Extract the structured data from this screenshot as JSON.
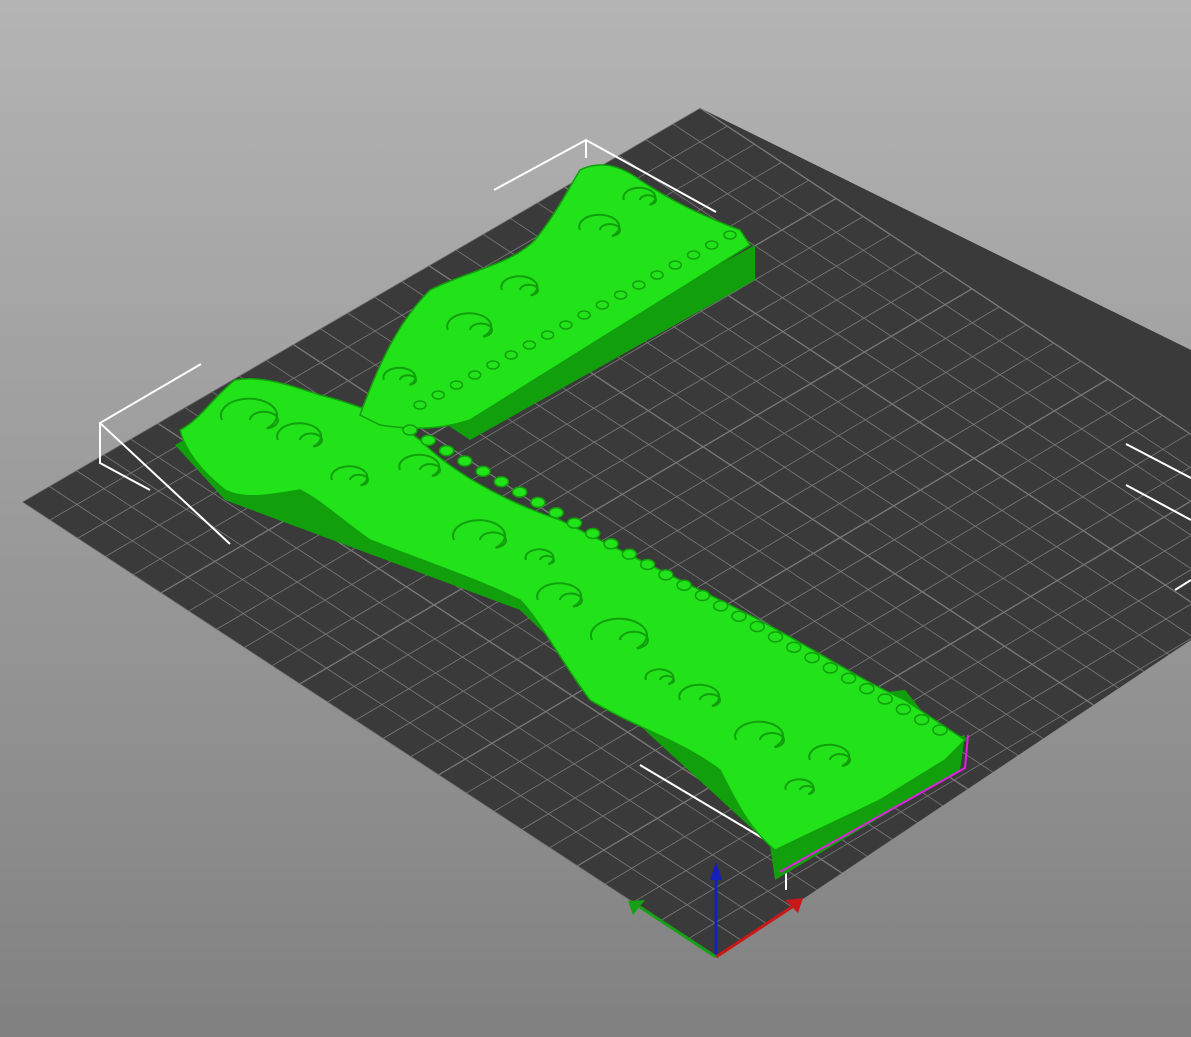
{
  "viewport": {
    "background_top_color": "#b4b4b4",
    "background_bottom_color": "#818181"
  },
  "bed": {
    "surface_color": "#3a3a3a",
    "grid_color": "#7a7a7a",
    "grid_divisions": 25
  },
  "model": {
    "color": "#22e31a",
    "shadow_color": "#119f0c",
    "selected": true,
    "bounding_box_color": "#ffffff"
  },
  "axes": {
    "x_color": "#c81818",
    "y_color": "#16a016",
    "z_color": "#1420b8"
  }
}
